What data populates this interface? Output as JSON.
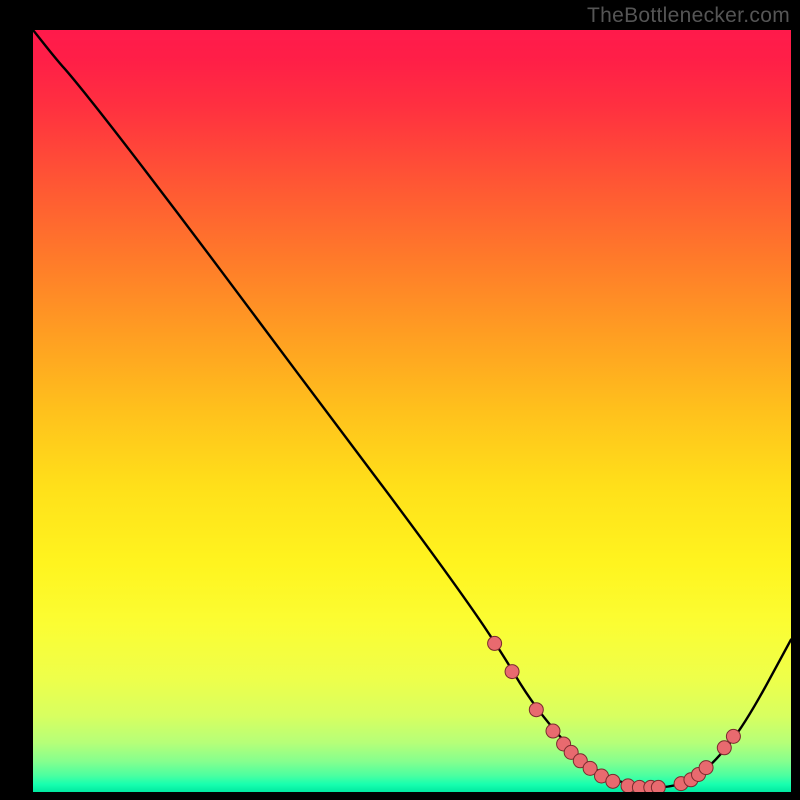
{
  "attribution": "TheBottlenecker.com",
  "chart_data": {
    "type": "line",
    "title": "",
    "xlabel": "",
    "ylabel": "",
    "xlim": [
      0,
      100
    ],
    "ylim": [
      0,
      100
    ],
    "background_gradient": {
      "stops": [
        {
          "offset": 0.0,
          "color": "#ff1a4b"
        },
        {
          "offset": 0.04,
          "color": "#ff1f47"
        },
        {
          "offset": 0.1,
          "color": "#ff3040"
        },
        {
          "offset": 0.2,
          "color": "#ff5634"
        },
        {
          "offset": 0.3,
          "color": "#ff7a2a"
        },
        {
          "offset": 0.4,
          "color": "#ff9e22"
        },
        {
          "offset": 0.5,
          "color": "#ffc11c"
        },
        {
          "offset": 0.6,
          "color": "#ffe01a"
        },
        {
          "offset": 0.7,
          "color": "#fff41f"
        },
        {
          "offset": 0.78,
          "color": "#fbfd33"
        },
        {
          "offset": 0.85,
          "color": "#eeff4a"
        },
        {
          "offset": 0.9,
          "color": "#d8ff60"
        },
        {
          "offset": 0.935,
          "color": "#b6ff78"
        },
        {
          "offset": 0.96,
          "color": "#85ff8e"
        },
        {
          "offset": 0.978,
          "color": "#4dffa0"
        },
        {
          "offset": 0.99,
          "color": "#17ffaf"
        },
        {
          "offset": 1.0,
          "color": "#00e8a0"
        }
      ]
    },
    "series": [
      {
        "name": "bottleneck-curve",
        "color": "#000000",
        "x": [
          0.0,
          3.2,
          5.0,
          10.0,
          20.0,
          30.0,
          40.0,
          50.0,
          58.0,
          62.0,
          65.0,
          68.0,
          72.0,
          76.0,
          80.0,
          84.0,
          87.0,
          90.0,
          94.0,
          100.0
        ],
        "y": [
          100.0,
          96.0,
          94.0,
          87.8,
          74.8,
          61.5,
          48.2,
          35.0,
          24.0,
          18.0,
          13.0,
          9.0,
          4.5,
          1.8,
          0.6,
          0.6,
          1.6,
          4.0,
          9.0,
          20.0
        ]
      }
    ],
    "markers": {
      "name": "highlight-points",
      "shape": "circle",
      "fill": "#e86a6f",
      "stroke": "#7a2b2e",
      "radius": 7,
      "points_xy": [
        [
          60.9,
          19.5
        ],
        [
          63.2,
          15.8
        ],
        [
          66.4,
          10.8
        ],
        [
          68.6,
          8.0
        ],
        [
          70.0,
          6.3
        ],
        [
          71.0,
          5.2
        ],
        [
          72.2,
          4.1
        ],
        [
          73.5,
          3.1
        ],
        [
          75.0,
          2.1
        ],
        [
          76.5,
          1.4
        ],
        [
          78.5,
          0.8
        ],
        [
          80.0,
          0.6
        ],
        [
          81.5,
          0.6
        ],
        [
          82.5,
          0.6
        ],
        [
          85.5,
          1.1
        ],
        [
          86.8,
          1.6
        ],
        [
          87.8,
          2.3
        ],
        [
          88.8,
          3.2
        ],
        [
          91.2,
          5.8
        ],
        [
          92.4,
          7.3
        ]
      ]
    }
  }
}
